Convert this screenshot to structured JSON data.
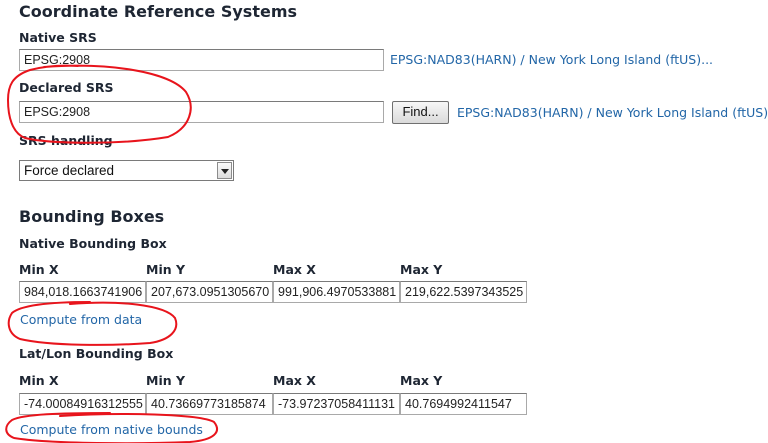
{
  "crs": {
    "title": "Coordinate Reference Systems",
    "native_srs_label": "Native SRS",
    "native_srs_value": "EPSG:2908",
    "native_srs_link": "EPSG:NAD83(HARN) / New York Long Island (ftUS)...",
    "declared_srs_label": "Declared SRS",
    "declared_srs_value": "EPSG:2908",
    "find_button": "Find...",
    "declared_srs_link": "EPSG:NAD83(HARN) / New York Long Island (ftUS)...",
    "srs_handling_label": "SRS handling",
    "srs_handling_value": "Force declared"
  },
  "bbox": {
    "title": "Bounding Boxes",
    "native_label": "Native Bounding Box",
    "native": {
      "headers": [
        "Min X",
        "Min Y",
        "Max X",
        "Max Y"
      ],
      "values": [
        "984,018.1663741906",
        "207,673.0951305670",
        "991,906.4970533881",
        "219,622.5397343525"
      ],
      "compute_link": "Compute from data"
    },
    "latlon_label": "Lat/Lon Bounding Box",
    "latlon": {
      "headers": [
        "Min X",
        "Min Y",
        "Max X",
        "Max Y"
      ],
      "values": [
        "-74.00084916312555",
        "40.73669773185874",
        "-73.97237058411131",
        "40.7694992411547"
      ],
      "compute_link": "Compute from native bounds"
    }
  },
  "annotation_color": "#e8141c"
}
